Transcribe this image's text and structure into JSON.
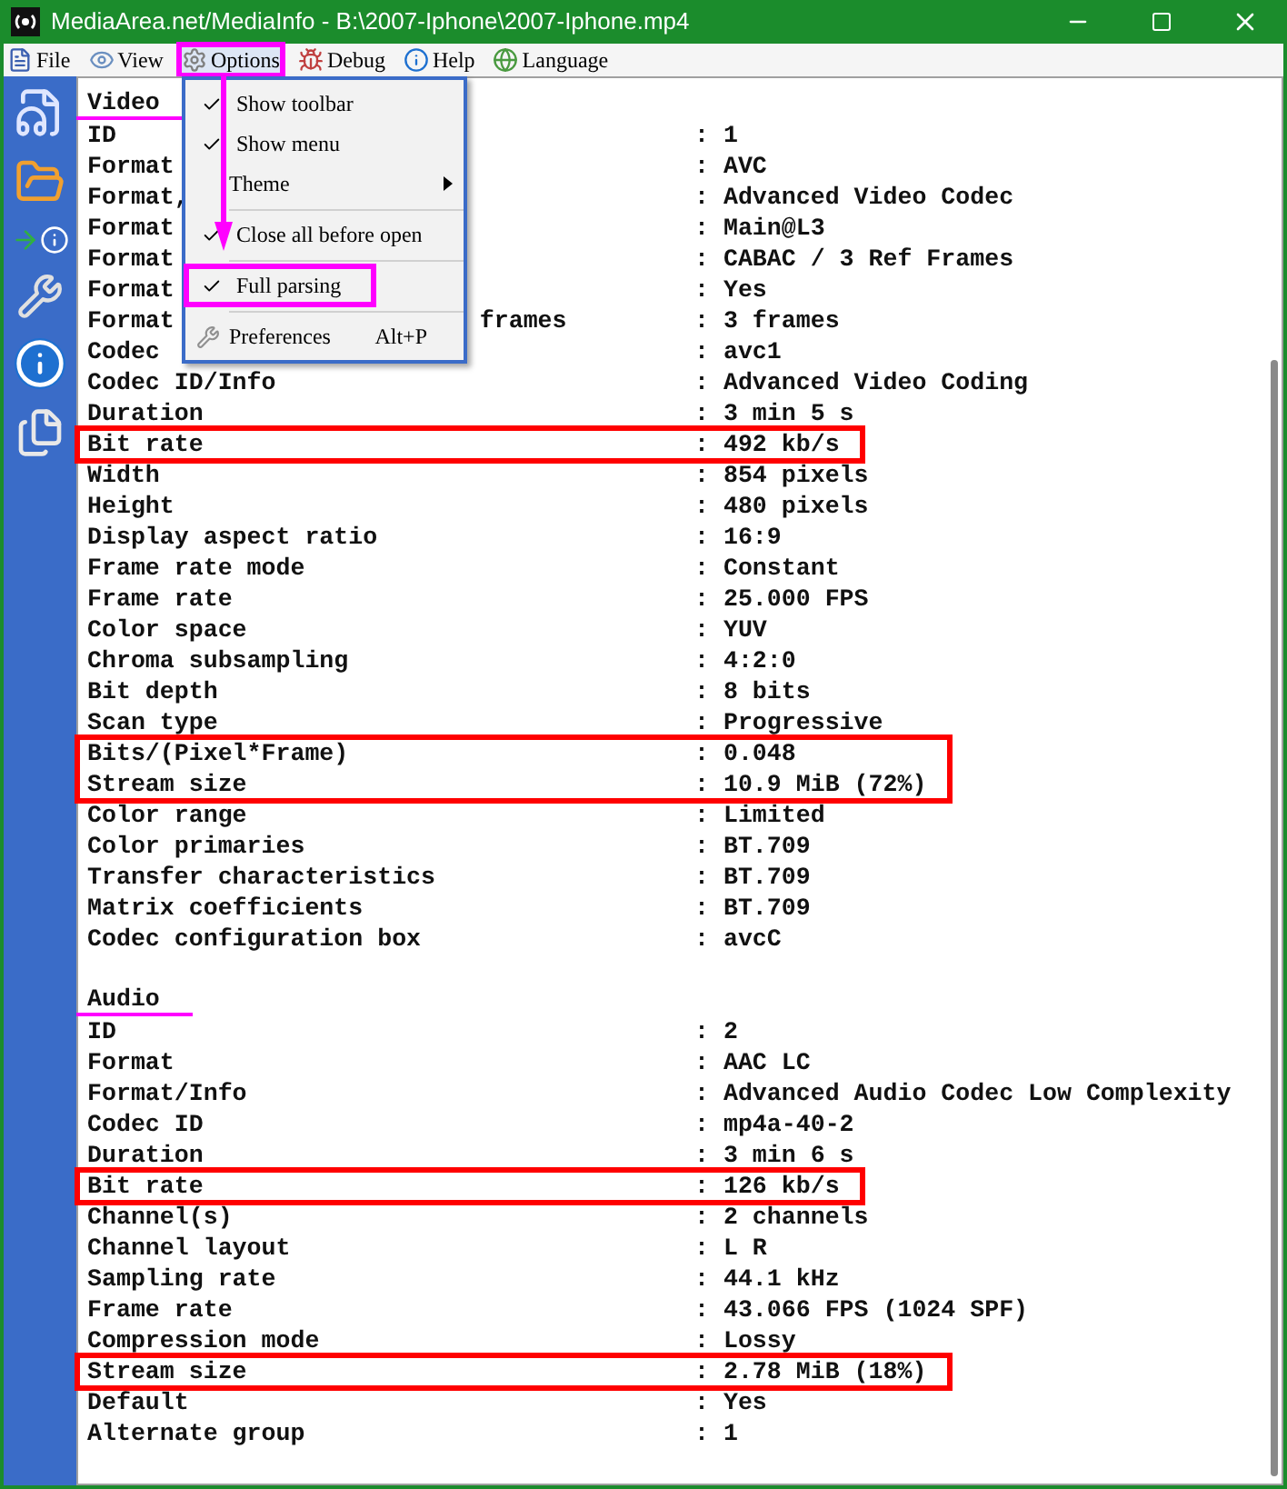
{
  "window": {
    "title": "MediaArea.net/MediaInfo - B:\\2007-Iphone\\2007-Iphone.mp4"
  },
  "menu_bar": [
    {
      "label": "File",
      "selected": false,
      "marked": false
    },
    {
      "label": "View",
      "selected": false,
      "marked": false
    },
    {
      "label": "Options",
      "selected": true,
      "marked": true
    },
    {
      "label": "Debug",
      "selected": false,
      "marked": false
    },
    {
      "label": "Help",
      "selected": false,
      "marked": false
    },
    {
      "label": "Language",
      "selected": false,
      "marked": false
    }
  ],
  "options_menu": {
    "items": [
      {
        "kind": "check",
        "label": "Show toolbar",
        "checked": true,
        "marked": false
      },
      {
        "kind": "check",
        "label": "Show menu",
        "checked": true,
        "marked": false
      },
      {
        "kind": "submenu",
        "label": "Theme"
      },
      {
        "kind": "separator"
      },
      {
        "kind": "check",
        "label": "Close all before open",
        "checked": true,
        "marked": false
      },
      {
        "kind": "separator"
      },
      {
        "kind": "check",
        "label": "Full parsing",
        "checked": true,
        "marked": true
      },
      {
        "kind": "separator"
      },
      {
        "kind": "command",
        "label": "Preferences",
        "shortcut": "Alt+P"
      }
    ]
  },
  "sections": [
    {
      "title": "Video",
      "underlined": true,
      "rows": [
        {
          "label": "ID",
          "value": ": 1",
          "boxed": false
        },
        {
          "label": "Format",
          "value": ": AVC",
          "boxed": false
        },
        {
          "label": "Format,",
          "value": ": Advanced Video Codec",
          "boxed": false
        },
        {
          "label": "Format",
          "value": ": Main@L3",
          "boxed": false
        },
        {
          "label": "Format",
          "value": ": CABAC / 3 Ref Frames",
          "boxed": false
        },
        {
          "label": "Format",
          "value": ": Yes",
          "boxed": false
        },
        {
          "label": "Format",
          "label_tail": "frames",
          "value": ": 3 frames",
          "boxed": false
        },
        {
          "label": "Codec",
          "value": ": avc1",
          "boxed": false
        },
        {
          "label": "Codec ID/Info",
          "value": ": Advanced Video Coding",
          "boxed": false
        },
        {
          "label": "Duration",
          "value": ": 3 min 5 s",
          "boxed": false
        },
        {
          "label": "Bit rate",
          "value": ": 492 kb/s",
          "boxed": true
        },
        {
          "label": "Width",
          "value": ": 854 pixels",
          "boxed": false
        },
        {
          "label": "Height",
          "value": ": 480 pixels",
          "boxed": false
        },
        {
          "label": "Display aspect ratio",
          "value": ": 16:9",
          "boxed": false
        },
        {
          "label": "Frame rate mode",
          "value": ": Constant",
          "boxed": false
        },
        {
          "label": "Frame rate",
          "value": ": 25.000 FPS",
          "boxed": false
        },
        {
          "label": "Color space",
          "value": ": YUV",
          "boxed": false
        },
        {
          "label": "Chroma subsampling",
          "value": ": 4:2:0",
          "boxed": false
        },
        {
          "label": "Bit depth",
          "value": ": 8 bits",
          "boxed": false
        },
        {
          "label": "Scan type",
          "value": ": Progressive",
          "boxed": false
        },
        {
          "label": "Bits/(Pixel*Frame)",
          "value": ": 0.048",
          "boxed": true
        },
        {
          "label": "Stream size",
          "value": ": 10.9 MiB (72%)",
          "boxed": true
        },
        {
          "label": "Color range",
          "value": ": Limited",
          "boxed": false
        },
        {
          "label": "Color primaries",
          "value": ": BT.709",
          "boxed": false
        },
        {
          "label": "Transfer characteristics",
          "value": ": BT.709",
          "boxed": false
        },
        {
          "label": "Matrix coefficients",
          "value": ": BT.709",
          "boxed": false
        },
        {
          "label": "Codec configuration box",
          "value": ": avcC",
          "boxed": false
        }
      ]
    },
    {
      "title": "Audio",
      "underlined": true,
      "rows": [
        {
          "label": "ID",
          "value": ": 2",
          "boxed": false
        },
        {
          "label": "Format",
          "value": ": AAC LC",
          "boxed": false
        },
        {
          "label": "Format/Info",
          "value": ": Advanced Audio Codec Low Complexity",
          "boxed": false
        },
        {
          "label": "Codec ID",
          "value": ": mp4a-40-2",
          "boxed": false
        },
        {
          "label": "Duration",
          "value": ": 3 min 6 s",
          "boxed": false
        },
        {
          "label": "Bit rate",
          "value": ": 126 kb/s",
          "boxed": true
        },
        {
          "label": "Channel(s)",
          "value": ": 2 channels",
          "boxed": false
        },
        {
          "label": "Channel layout",
          "value": ": L R",
          "boxed": false
        },
        {
          "label": "Sampling rate",
          "value": ": 44.1 kHz",
          "boxed": false
        },
        {
          "label": "Frame rate",
          "value": ": 43.066 FPS (1024 SPF)",
          "boxed": false
        },
        {
          "label": "Compression mode",
          "value": ": Lossy",
          "boxed": false
        },
        {
          "label": "Stream size",
          "value": ": 2.78 MiB (18%)",
          "boxed": true
        },
        {
          "label": "Default",
          "value": ": Yes",
          "boxed": false
        },
        {
          "label": "Alternate group",
          "value": ": 1",
          "boxed": false
        }
      ]
    }
  ]
}
